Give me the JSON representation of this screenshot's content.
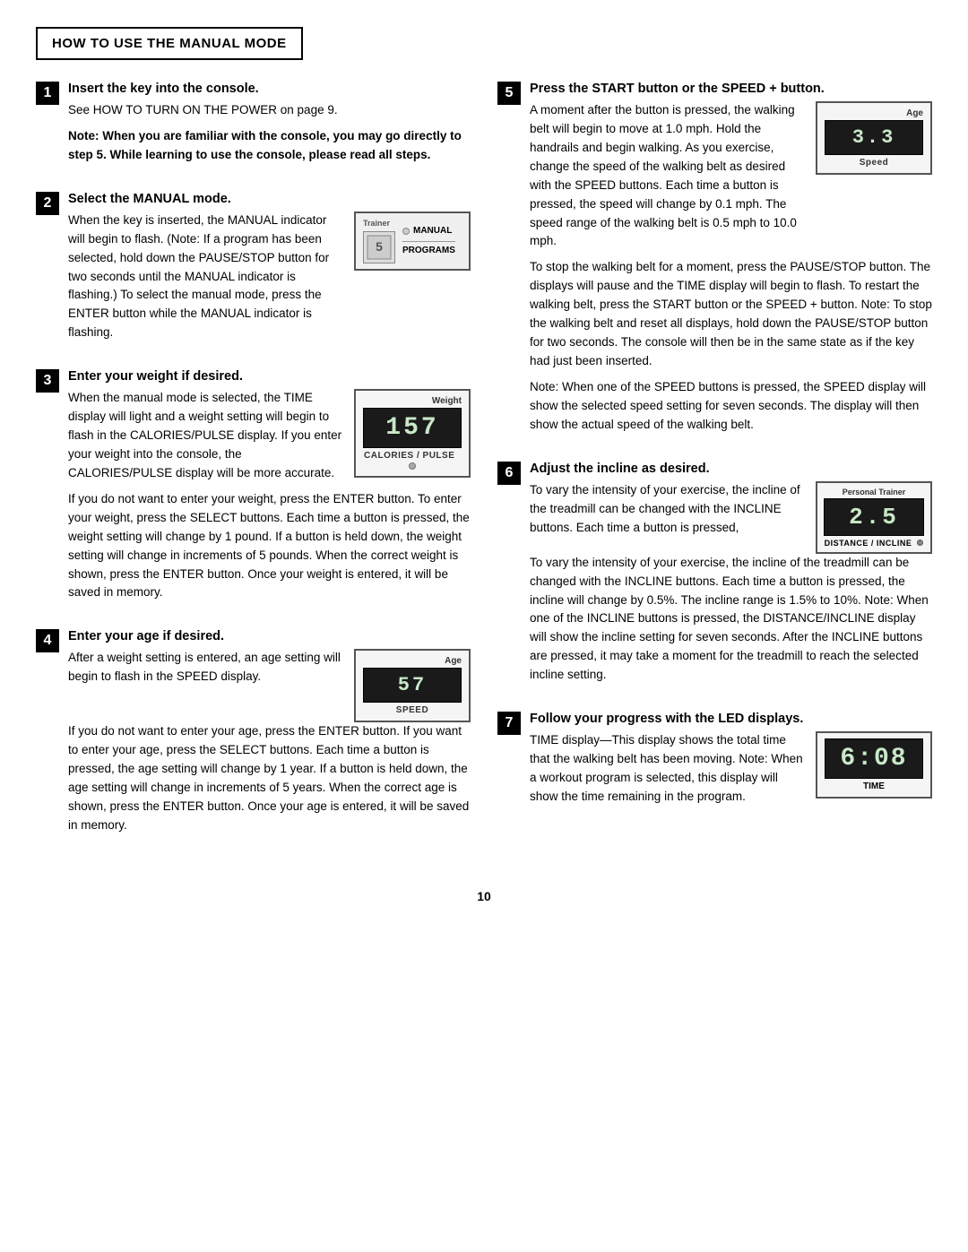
{
  "header": {
    "title": "HOW TO USE THE MANUAL MODE"
  },
  "steps": {
    "step1": {
      "number": "1",
      "title": "Insert the key into the console.",
      "body1": "See HOW TO TURN ON THE POWER on page 9.",
      "body2": "Note: When you are familiar with the console, you may go directly to step 5. While learning to use the console, please read all steps."
    },
    "step2": {
      "number": "2",
      "title": "Select the MANUAL mode.",
      "body1": "When the key is inserted, the MANUAL indicator will begin to flash. (Note: If a program has been selected, hold down the PAUSE/STOP button for two seconds until the MANUAL indicator is flashing.) To select the manual mode, press the ENTER button while the MANUAL indicator is flashing.",
      "panel": {
        "trainer_label": "Trainer",
        "manual_label": "MANUAL",
        "programs_label": "PROGRAMS"
      }
    },
    "step3": {
      "number": "3",
      "title": "Enter your weight if desired.",
      "body1": "When the manual mode is selected, the TIME display will light and a weight setting will begin to flash in the CALORIES/PULSE display. If you enter your weight into the console, the CALORIES/PULSE display will be more accurate.",
      "body2": "If you do not want to enter your weight, press the ENTER button. To enter your weight, press the SELECT buttons. Each time a button is pressed, the weight setting will change by 1 pound. If a button is held down, the weight setting will change in increments of 5 pounds. When the correct weight is shown, press the ENTER button. Once your weight is entered, it will be saved in memory.",
      "display": {
        "top_label": "Weight",
        "value": "157",
        "bottom_label": "CALORIES / PULSE"
      }
    },
    "step4": {
      "number": "4",
      "title": "Enter your age if desired.",
      "body1": "After a weight setting is entered, an age setting will begin to flash in the SPEED display.",
      "body2": "If you do not want to enter your age, press the ENTER button. If you want to enter your age, press the SELECT buttons. Each time a button is pressed, the age setting will change by 1 year. If a button is held down, the age setting will change in increments of 5 years. When the correct age is shown, press the ENTER button. Once your age is entered, it will be saved in memory.",
      "display": {
        "top_label": "Age",
        "value": "57",
        "bottom_label": "SPEED"
      }
    },
    "step5": {
      "number": "5",
      "title": "Press the START button or the SPEED + button.",
      "body1": "A moment after the button is pressed, the walking belt will begin to move at 1.0 mph. Hold the handrails and begin walking. As you exercise, change the speed of the walking belt as desired with the SPEED buttons. Each time a button is pressed, the speed will change by 0.1 mph. The speed range of the walking belt is 0.5 mph to 10.0 mph.",
      "body2": "To stop the walking belt for a moment, press the PAUSE/STOP button. The displays will pause and the TIME display will begin to flash. To restart the walking belt, press the START button or the SPEED + button. Note: To stop the walking belt and reset all displays, hold down the PAUSE/STOP button for two seconds. The console will then be in the same state as if the key had just been inserted.",
      "body3": "Note: When one of the SPEED buttons is pressed, the SPEED display will show the selected speed setting for seven seconds. The display will then show the actual speed of the walking belt.",
      "display": {
        "top_label": "Age",
        "value": "3.3",
        "bottom_label": "Speed"
      }
    },
    "step6": {
      "number": "6",
      "title": "Adjust the incline as desired.",
      "body1": "To vary the intensity of your exercise, the incline of the treadmill can be changed with the INCLINE buttons. Each time a button is pressed, the incline will change by 0.5%. The incline range is 1.5% to 10%. Note: When one of the INCLINE buttons is pressed, the DISTANCE/INCLINE display will show the incline setting for seven seconds. After the INCLINE buttons are pressed, it may take a moment for the treadmill to reach the selected incline setting.",
      "display": {
        "top_label": "Personal Trainer",
        "value": "2.5",
        "bottom_label": "DISTANCE / INCLINE"
      }
    },
    "step7": {
      "number": "7",
      "title": "Follow your progress with the LED displays.",
      "time_label": "TIME display",
      "body1": "TIME display—This display shows the total time that the walking belt has been moving. Note: When a workout program is selected, this display will show the time remaining in the program.",
      "display": {
        "value": "6:08",
        "bottom_label": "TIME"
      }
    }
  },
  "page_number": "10"
}
